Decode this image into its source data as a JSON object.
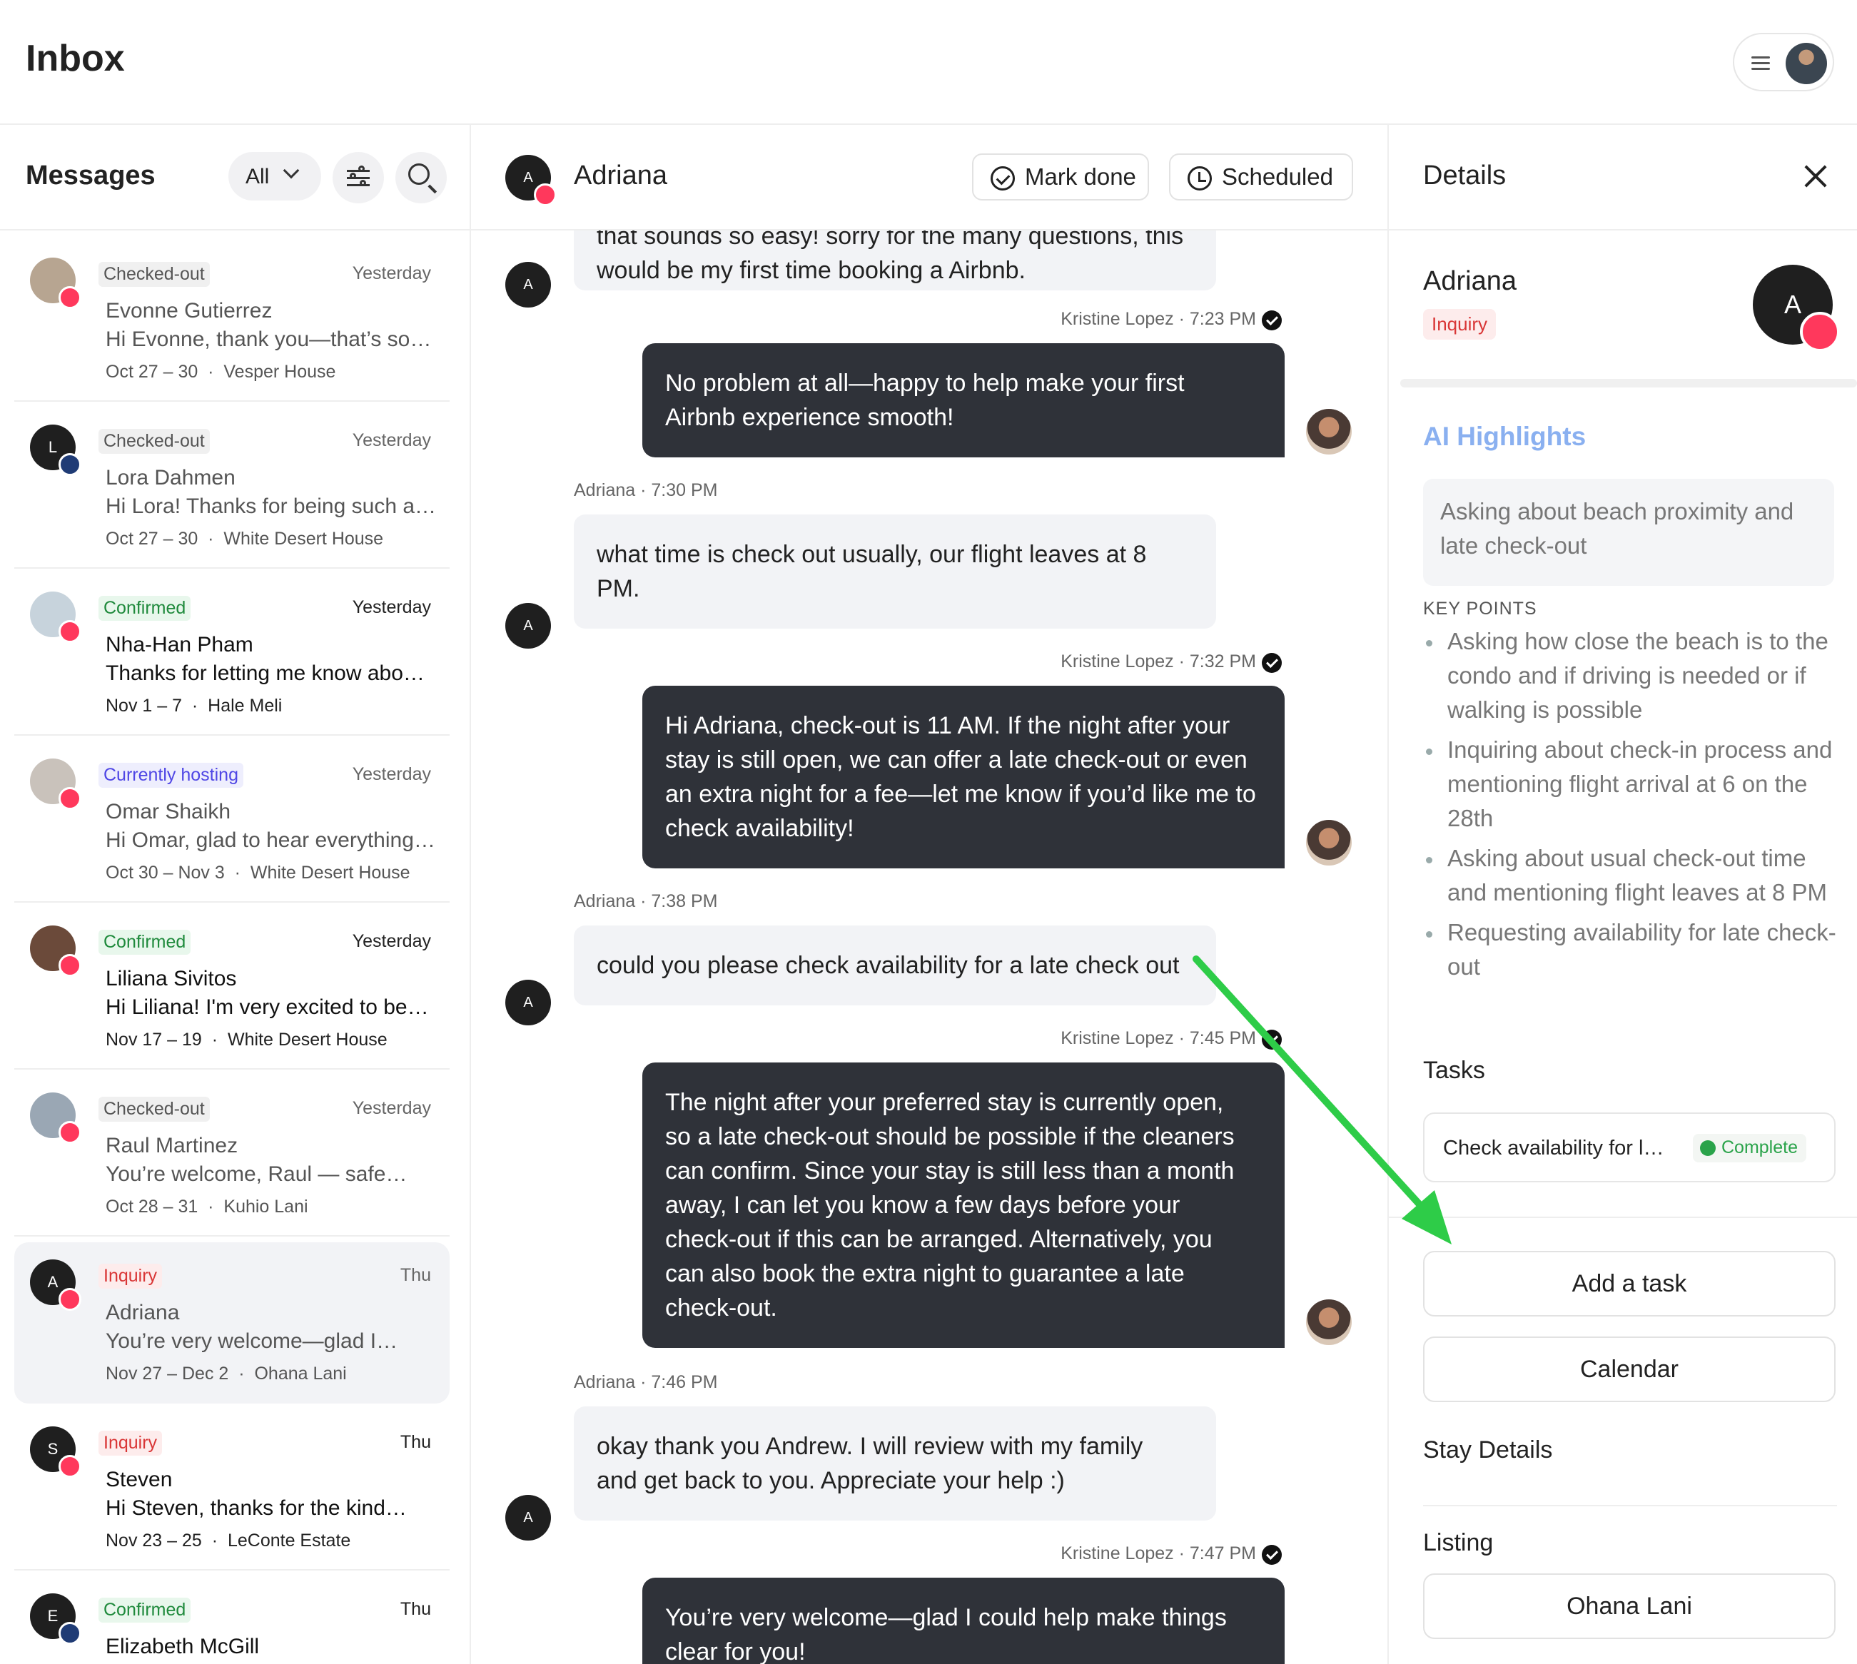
{
  "app": {
    "title": "Inbox"
  },
  "messages_panel": {
    "title": "Messages",
    "filter_label": "All",
    "conversations": [
      {
        "tag": "Checked-out",
        "when": "Yesterday",
        "name": "Evonne Gutierrez",
        "preview": "Hi Evonne, thank you—that’s so…",
        "dates": "Oct 27 – 30",
        "listing": "Vesper House"
      },
      {
        "tag": "Checked-out",
        "when": "Yesterday",
        "name": "Lora Dahmen",
        "preview": "Hi Lora! Thanks for being such a…",
        "dates": "Oct 27 – 30",
        "listing": "White Desert House",
        "avatar_letter": "L"
      },
      {
        "tag": "Confirmed",
        "when": "Yesterday",
        "name": "Nha-Han Pham",
        "preview": "Thanks for letting me know abo…",
        "dates": "Nov 1 – 7",
        "listing": "Hale Meli"
      },
      {
        "tag": "Currently hosting",
        "when": "Yesterday",
        "name": "Omar Shaikh",
        "preview": "Hi Omar, glad to hear everything…",
        "dates": "Oct 30 – Nov 3",
        "listing": "White Desert House"
      },
      {
        "tag": "Confirmed",
        "when": "Yesterday",
        "name": "Liliana Sivitos",
        "preview": "Hi Liliana! I'm very excited to be…",
        "dates": "Nov 17 – 19",
        "listing": "White Desert House"
      },
      {
        "tag": "Checked-out",
        "when": "Yesterday",
        "name": "Raul Martinez",
        "preview": "You’re welcome, Raul — safe…",
        "dates": "Oct 28 – 31",
        "listing": "Kuhio Lani"
      },
      {
        "tag": "Inquiry",
        "when": "Thu",
        "name": "Adriana",
        "preview": "You’re very welcome—glad I…",
        "dates": "Nov 27 – Dec 2",
        "listing": "Ohana Lani",
        "avatar_letter": "A"
      },
      {
        "tag": "Inquiry",
        "when": "Thu",
        "name": "Steven",
        "preview": "Hi Steven, thanks for the kind…",
        "dates": "Nov 23 – 25",
        "listing": "LeConte Estate",
        "avatar_letter": "S"
      },
      {
        "tag": "Confirmed",
        "when": "Thu",
        "name": "Elizabeth McGill",
        "avatar_letter": "E"
      }
    ],
    "separator": "·"
  },
  "thread": {
    "guest_name": "Adriana",
    "avatar_letter": "A",
    "mark_done_label": "Mark done",
    "scheduled_label": "Scheduled",
    "messages": [
      {
        "text_lines": [
          "that sounds so easy! sorry for the many questions, this",
          "would be my first time booking a Airbnb."
        ]
      },
      {
        "sender": "Kristine Lopez · 7:23 PM",
        "text_lines": [
          "No problem at all—happy to help make your first",
          "Airbnb experience smooth!"
        ]
      },
      {
        "sender": "Adriana · 7:30 PM",
        "text_lines": [
          "what time is check out usually, our flight leaves at 8",
          "PM."
        ]
      },
      {
        "sender": "Kristine Lopez · 7:32 PM",
        "text_lines": [
          "Hi Adriana, check-out is 11 AM. If the night after your",
          "stay is still open, we can offer a late check-out or even",
          "an extra night for a fee—let me know if you’d like me to",
          "check availability!"
        ]
      },
      {
        "sender": "Adriana · 7:38 PM",
        "text_lines": [
          "could you please check availability for a late check out"
        ]
      },
      {
        "sender": "Kristine Lopez · 7:45 PM",
        "text_lines": [
          "The night after your preferred stay is currently open,",
          "so a late check-out should be possible if the cleaners",
          "can confirm. Since your stay is still less than a month",
          "away, I can let you know a few days before your",
          "check-out if this can be arranged. Alternatively, you",
          "can also book the extra night to guarantee a late",
          "check-out."
        ]
      },
      {
        "sender": "Adriana · 7:46 PM",
        "text_lines": [
          "okay thank you Andrew. I will review with my family",
          "and get back to you. Appreciate your help :)"
        ]
      },
      {
        "sender": "Kristine Lopez · 7:47 PM",
        "text_lines": [
          "You’re very welcome—glad I could help make things",
          "clear for you!"
        ]
      }
    ]
  },
  "details": {
    "title": "Details",
    "guest_name": "Adriana",
    "status_tag": "Inquiry",
    "avatar_letter": "A",
    "ai_highlights_title": "AI Highlights",
    "ai_summary": "Asking about beach proximity and late check-out",
    "key_points_title": "KEY POINTS",
    "key_points": [
      "Asking how close the beach is to the condo and if driving is needed or if walking is possible",
      "Inquiring about check-in process and mentioning flight arrival at 6 on the 28th",
      "Asking about usual check-out time and mentioning flight leaves at 8 PM",
      "Requesting availability for late check-out"
    ],
    "tasks_title": "Tasks",
    "task": {
      "label": "Check availability for l…",
      "status": "Complete"
    },
    "add_task_label": "Add a task",
    "calendar_label": "Calendar",
    "stay_details_title": "Stay Details",
    "listing_title": "Listing",
    "listing_name": "Ohana Lani"
  },
  "colors": {
    "airbnb_badge": "#ff385c",
    "host_bubble": "#2f3239",
    "guest_bubble": "#f2f3f6",
    "annotation_arrow": "#2ecc48",
    "ai_highlights": "#8ab0f0"
  }
}
